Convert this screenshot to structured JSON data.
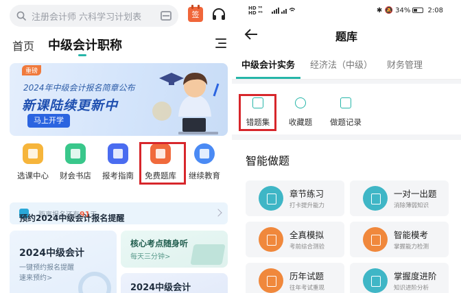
{
  "left_screen": {
    "search": {
      "placeholder": "注册会计师 六科学习计划表",
      "icon": "search-icon",
      "scan_icon": "scan-icon"
    },
    "header_icons": {
      "calendar_label": "签",
      "calendar_color": "#f0663a",
      "headset_icon": "headset-icon"
    },
    "nav": {
      "home": "首页",
      "current": "中级会计职称",
      "menu_icon": "menu-icon"
    },
    "banner": {
      "tag": "重磅",
      "subtitle": "2024年中级会计报名简章公布",
      "headline": "新课陆续更新中",
      "button": "马上开学"
    },
    "quick_links": [
      {
        "label": "选课中心",
        "icon": "play-course-icon",
        "color": "#f6b53b"
      },
      {
        "label": "财会书店",
        "icon": "bookstore-icon",
        "color": "#39c78b"
      },
      {
        "label": "报考指南",
        "icon": "guide-icon",
        "color": "#4a6cf0"
      },
      {
        "label": "免费题库",
        "icon": "question-bank-icon",
        "color": "#f06a3c"
      },
      {
        "label": "继续教育",
        "icon": "education-icon",
        "color": "#4a8af4"
      }
    ],
    "reminder": {
      "title": "预约2024中级会计报名提醒",
      "subtitle_prefix": "距离报名还有",
      "days": "91",
      "subtitle_suffix": "天"
    },
    "card_left": {
      "title": "2024中级会计",
      "line1": "一键预约报名提醒",
      "line2": "速来预约>"
    },
    "card_right_top": {
      "title": "核心考点随身听",
      "subtitle": "每天三分钟>"
    },
    "card_right_bottom": {
      "title": "2024中级会计"
    }
  },
  "right_screen": {
    "status": {
      "left_line1": "HD ⁵⁶",
      "left_line2": "HD ⁴ᴳ",
      "battery": "34%",
      "time": "2:08"
    },
    "header": {
      "title": "题库",
      "back_icon": "back-arrow-icon"
    },
    "tabs": [
      {
        "label": "中级会计实务",
        "active": true
      },
      {
        "label": "经济法（中级）",
        "active": false
      },
      {
        "label": "财务管理",
        "active": false
      }
    ],
    "tools": [
      {
        "label": "错题集",
        "icon": "wrong-book-icon"
      },
      {
        "label": "收藏题",
        "icon": "star-icon"
      },
      {
        "label": "做题记录",
        "icon": "record-icon"
      }
    ],
    "smart": {
      "title": "智能做题",
      "items": [
        {
          "title": "章节练习",
          "subtitle": "打卡提升能力",
          "icon": "chapter-icon",
          "color": "#3fb6c6"
        },
        {
          "title": "一对一出题",
          "subtitle": "消除薄弱知识",
          "icon": "one-on-one-icon",
          "color": "#3fb6c6"
        },
        {
          "title": "全真模拟",
          "subtitle": "考前综合测验",
          "icon": "mock-icon",
          "color": "#f0883c"
        },
        {
          "title": "智能模考",
          "subtitle": "掌握能力检测",
          "icon": "smart-exam-icon",
          "color": "#f0883c"
        },
        {
          "title": "历年试题",
          "subtitle": "往年考试重现",
          "icon": "past-exam-icon",
          "color": "#f0883c"
        },
        {
          "title": "掌握度进阶",
          "subtitle": "知识进阶分析",
          "icon": "mastery-icon",
          "color": "#3fb6c6"
        }
      ]
    }
  }
}
